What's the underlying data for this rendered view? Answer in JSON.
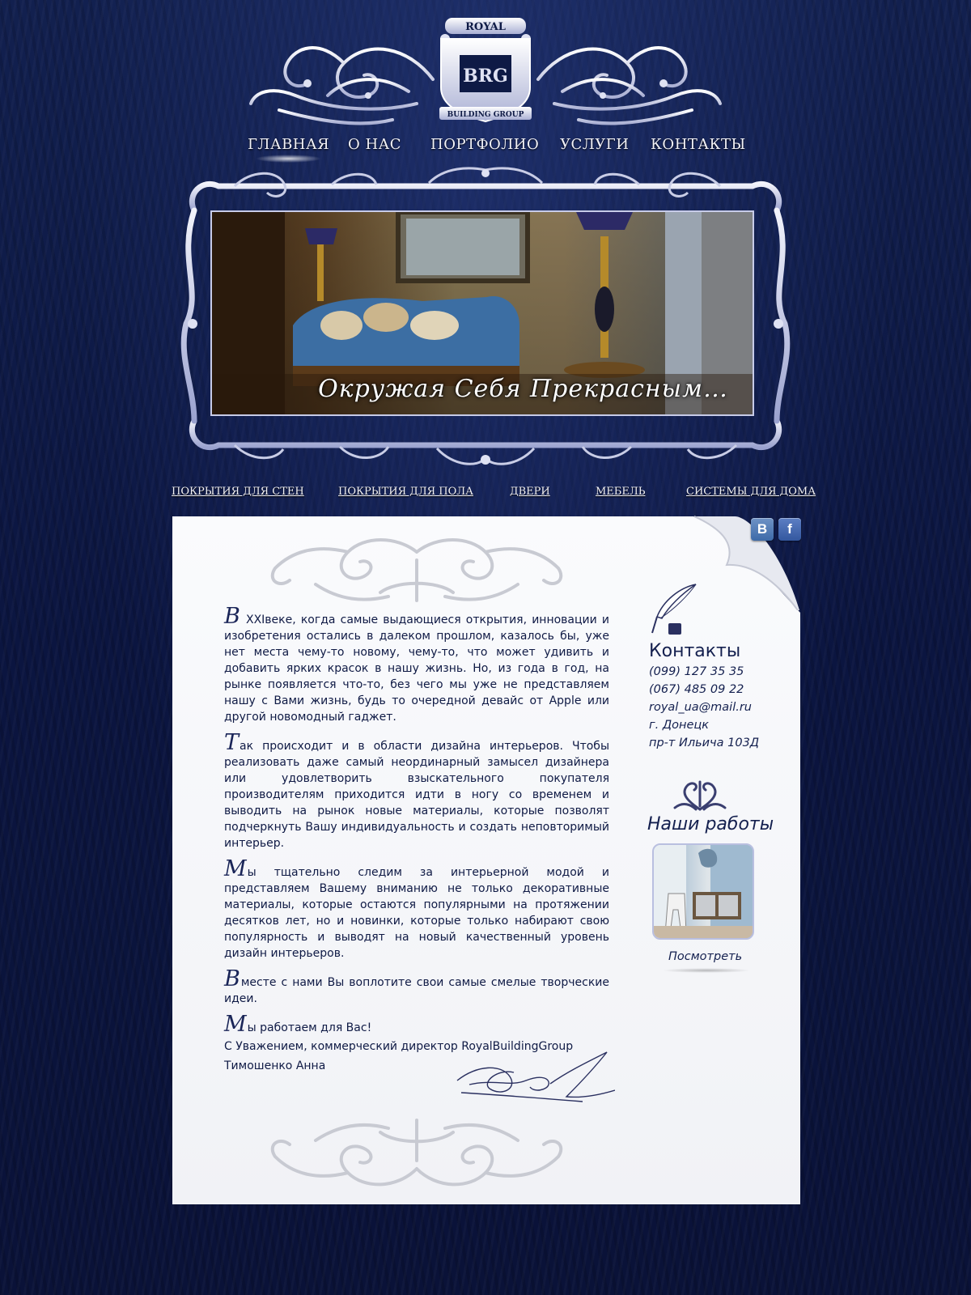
{
  "logo": {
    "top_text": "ROYAL",
    "mark": "BRG",
    "bottom_text": "BUILDING GROUP"
  },
  "nav": [
    {
      "label": "ГЛАВНАЯ",
      "active": true
    },
    {
      "label": "О НАС"
    },
    {
      "label": "ПОРТФОЛИО"
    },
    {
      "label": "УСЛУГИ"
    },
    {
      "label": "КОНТАКТЫ"
    }
  ],
  "banner": {
    "slogan": "Окружая Себя Прекрасным…"
  },
  "categories": [
    "ПОКРЫТИЯ ДЛЯ СТЕН",
    "ПОКРЫТИЯ ДЛЯ ПОЛА",
    "ДВЕРИ",
    "МЕБЕЛЬ",
    "СИСТЕМЫ ДЛЯ ДОМА"
  ],
  "social": {
    "vk": "B",
    "facebook": "f"
  },
  "letter": {
    "paragraphs": [
      {
        "initial": "В",
        "text": " XXIвеке, когда самые выдающиеся открытия, инновации и изобретения остались в далеком прошлом, казалось бы, уже нет места чему-то новому, чему-то, что может удивить и добавить ярких красок в нашу жизнь. Но, из года в год, на рынке появляется что-то, без чего мы уже не представляем нашу с Вами жизнь, будь то очередной девайс от Apple или другой новомодный гаджет."
      },
      {
        "initial": "Т",
        "text": "ак происходит и в области дизайна интерьеров. Чтобы реализовать даже самый неординарный замысел дизайнера или удовлетворить взыскательного покупателя производителям приходится идти в ногу со временем и выводить на рынок новые материалы, которые позволят подчеркнуть Вашу индивидуальность и создать неповторимый интерьер."
      },
      {
        "initial": "М",
        "text": "ы тщательно следим за интерьерной модой и представляем Вашему вниманию не только декоративные материалы, которые остаются популярными на протяжении десятков лет, но и новинки, которые только набирают свою популярность и выводят на новый качественный уровень  дизайн интерьеров."
      },
      {
        "initial": "В",
        "text": "месте с нами Вы воплотите свои самые  смелые  творческие идеи."
      },
      {
        "initial": "М",
        "text": "ы работаем для Вас!"
      }
    ],
    "signoff_line1": "С Уважением,  коммерческий директор RoyalBuildingGroup",
    "signoff_line2": "Тимошенко Анна"
  },
  "sidebar": {
    "contacts_title": "Контакты",
    "phone1": "(099) 127 35 35",
    "phone2": "(067) 485 09 22",
    "email": "royal_ua@mail.ru",
    "city": "г. Донецк",
    "address": "пр-т Ильича 103Д",
    "works_title": "Наши работы",
    "view_label": "Посмотреть"
  },
  "colors": {
    "background": "#0e1a45",
    "text": "#0f1a45",
    "ornament": "#c9cde6"
  }
}
